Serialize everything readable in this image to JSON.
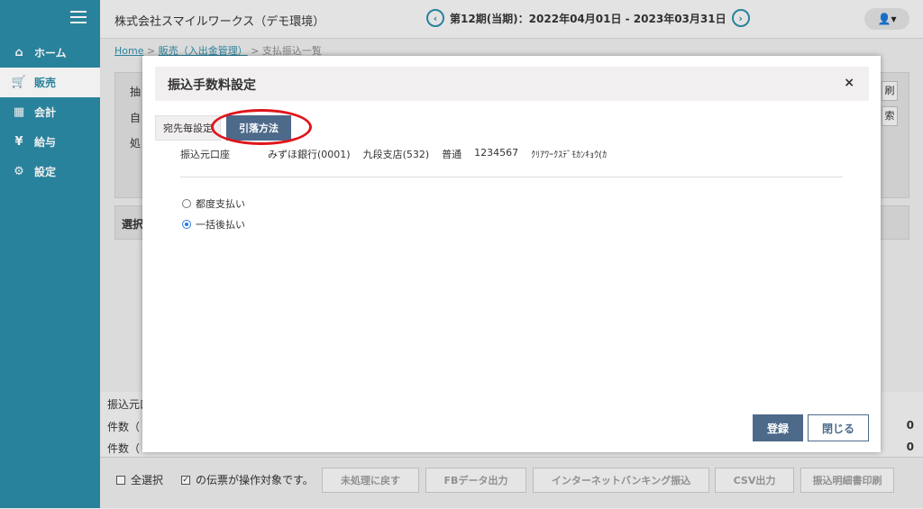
{
  "sidebar": {
    "items": [
      {
        "label": "ホーム",
        "icon": "home-icon"
      },
      {
        "label": "販売",
        "icon": "cart-icon"
      },
      {
        "label": "会計",
        "icon": "calculator-icon"
      },
      {
        "label": "給与",
        "icon": "money-bag-icon"
      },
      {
        "label": "設定",
        "icon": "gear-icon"
      }
    ]
  },
  "header": {
    "company": "株式会社スマイルワークス（デモ環境）",
    "period": "第12期(当期)：2022年04月01日 - 2023年03月31日"
  },
  "breadcrumb": {
    "home": "Home",
    "sales": "販売（入出金管理）",
    "current": "支払振込一覧"
  },
  "background": {
    "filter_label": "抽",
    "self_label": "自",
    "process_label": "処",
    "select_label": "選択",
    "btn_right1": "刷",
    "btn_right2": "索",
    "summary": [
      {
        "label": "振込元口",
        "value": ""
      },
      {
        "label": "件数（",
        "value": "0"
      },
      {
        "label": "件数（",
        "value": "0"
      }
    ]
  },
  "footer": {
    "select_all": "全選択",
    "target_note": "の伝票が操作対象です。",
    "buttons": [
      "未処理に戻す",
      "FBデータ出力",
      "インターネットバンキング振込",
      "CSV出力",
      "振込明細書印刷"
    ]
  },
  "modal": {
    "title": "振込手数料設定",
    "close": "×",
    "tab_inactive": "宛先毎設定",
    "tab_active": "引落方法",
    "account": {
      "label": "振込元口座",
      "bank": "みずほ銀行(0001)",
      "branch": "九段支店(532)",
      "type": "普通",
      "number": "1234567",
      "holder": "ｸﾘｱﾜｰｸｽﾃﾞﾓｶﾝｷｮｳ(ｶ"
    },
    "options": [
      {
        "label": "都度支払い",
        "selected": false
      },
      {
        "label": "一括後払い",
        "selected": true
      }
    ],
    "register": "登録",
    "close_button": "閉じる"
  },
  "colors": {
    "sidebar": "#2c8ba6",
    "primary_button": "#4d6a8a",
    "highlight": "#e0151b"
  }
}
